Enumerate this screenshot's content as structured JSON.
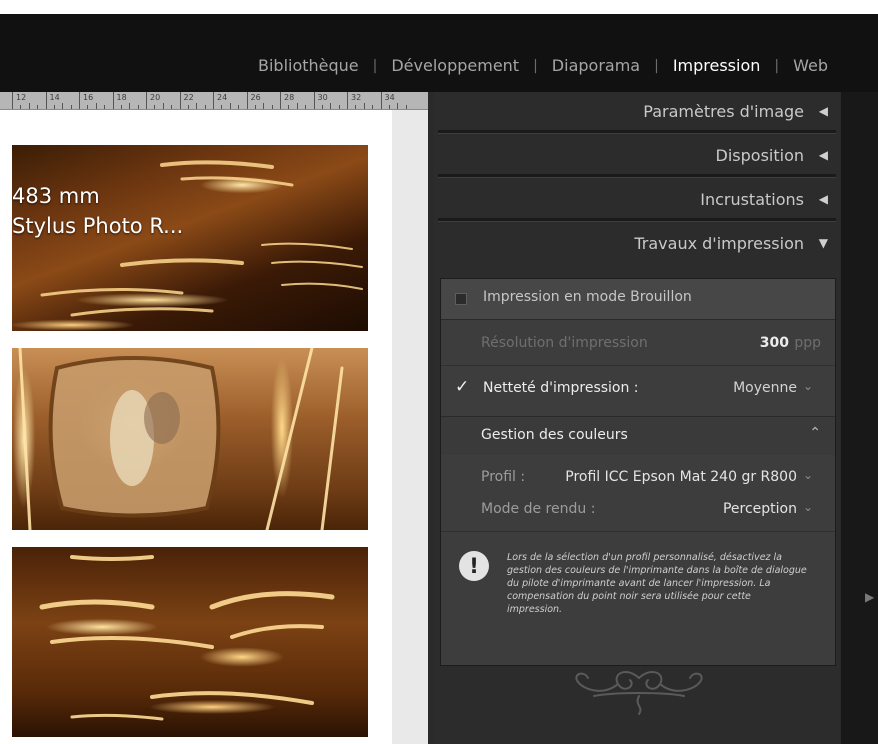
{
  "modules": {
    "library": "Bibliothèque",
    "develop": "Développement",
    "slideshow": "Diaporama",
    "print": "Impression",
    "web": "Web",
    "separator": "|",
    "active": "print"
  },
  "ruler": {
    "labels": [
      "12",
      "14",
      "16",
      "18",
      "20",
      "22",
      "24",
      "26",
      "28",
      "30",
      "32",
      "34"
    ]
  },
  "canvas": {
    "overlay_line_1": "483 mm",
    "overlay_line_2": "Stylus Photo R..."
  },
  "panels": {
    "image_settings": "Paramètres d'image",
    "layout": "Disposition",
    "overlays": "Incrustations",
    "print_job": "Travaux d'impression"
  },
  "print_job": {
    "draft_mode_label": "Impression en mode Brouillon",
    "draft_mode_checked": false,
    "resolution_label": "Résolution d'impression",
    "resolution_value": "300",
    "resolution_unit": "ppp",
    "sharpness_label": "Netteté d'impression :",
    "sharpness_checked": true,
    "sharpness_value": "Moyenne",
    "color_management_label": "Gestion des couleurs",
    "profile_label": "Profil :",
    "profile_value": "Profil ICC Epson Mat 240 gr R800",
    "rendering_label": "Mode de rendu :",
    "rendering_value": "Perception",
    "warning_text": "Lors de la sélection d'un profil personnalisé, désactivez la gestion des couleurs de l'imprimante dans la boîte de dialogue du pilote d'imprimante avant de lancer l'impression. La compensation du point noir sera utilisée pour cette impression."
  },
  "icons": {
    "collapsed_triangle": "◀",
    "expanded_triangle": "▼",
    "checkmark": "✓",
    "dropdown_chevron": "⌄",
    "collapse_double_chevron": "⌃",
    "warning": "!",
    "side_panel_arrow": "▶"
  },
  "colors": {
    "window_bg": "#111111",
    "panel_bg": "#2c2c2c",
    "active_module": "#ffffff",
    "inactive_module": "#a5a5a5"
  }
}
